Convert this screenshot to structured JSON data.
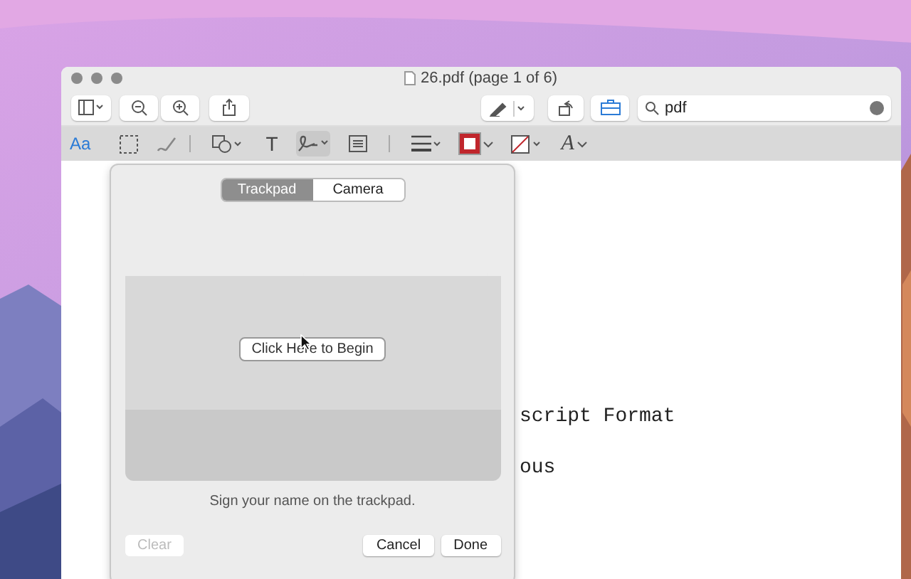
{
  "window": {
    "title": "26.pdf (page 1 of 6)"
  },
  "search": {
    "value": "pdf"
  },
  "markup_tools": [
    {
      "kind": "text-style",
      "label": "Aa"
    },
    {
      "kind": "select"
    },
    {
      "kind": "sketch"
    },
    {
      "kind": "separator"
    },
    {
      "kind": "shapes"
    },
    {
      "kind": "text",
      "label": "T"
    },
    {
      "kind": "signature",
      "selected": true
    },
    {
      "kind": "note"
    },
    {
      "kind": "separator"
    },
    {
      "kind": "lines"
    },
    {
      "kind": "border",
      "color": "#c0262c"
    },
    {
      "kind": "fill"
    },
    {
      "kind": "font",
      "label": "A"
    }
  ],
  "document": {
    "lines": [
      "script Format",
      "ous"
    ]
  },
  "signature_popover": {
    "tabs": [
      {
        "label": "Trackpad",
        "selected": true
      },
      {
        "label": "Camera",
        "selected": false
      }
    ],
    "begin_button": "Click Here to Begin",
    "hint": "Sign your name on the trackpad.",
    "buttons": [
      {
        "label": "Clear",
        "disabled": true
      },
      {
        "label": "Cancel",
        "disabled": false
      },
      {
        "label": "Done",
        "disabled": false
      }
    ]
  }
}
